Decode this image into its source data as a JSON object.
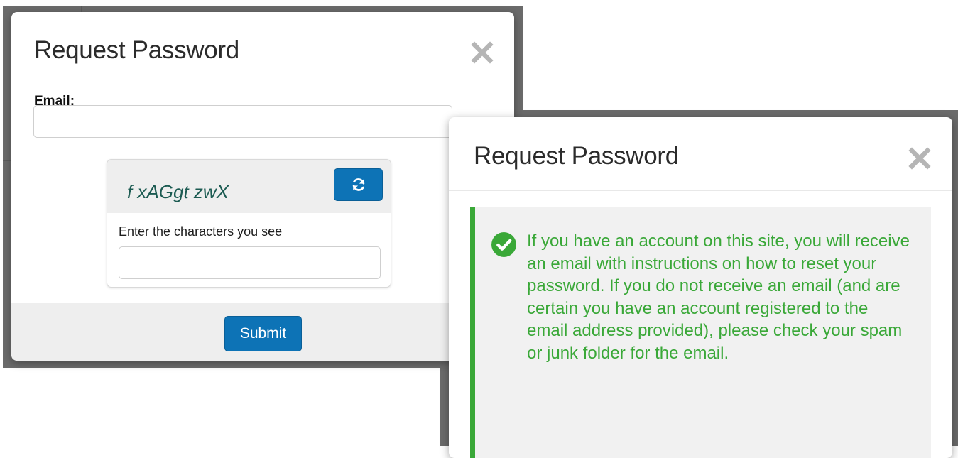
{
  "colors": {
    "primary": "#0d73b6",
    "success": "#3aa838",
    "overlay": "#6b6b6b",
    "close_icon": "#b5b5b5"
  },
  "request_modal": {
    "title": "Request Password",
    "close_icon": "close-icon",
    "email_label": "Email:",
    "email_value": "",
    "captcha": {
      "image_text": "f xAGgt zwX",
      "refresh_icon": "refresh-icon",
      "prompt": "Enter the characters you see",
      "input_value": ""
    },
    "submit_label": "Submit"
  },
  "confirmation_modal": {
    "title": "Request Password",
    "close_icon": "close-icon",
    "status_icon": "check-circle-icon",
    "message": "If you have an account on this site, you will receive an email with instructions on how to reset your password. If you do not receive an email (and are certain you have an account registered to the email address provided), please check your spam or junk folder for the email."
  }
}
